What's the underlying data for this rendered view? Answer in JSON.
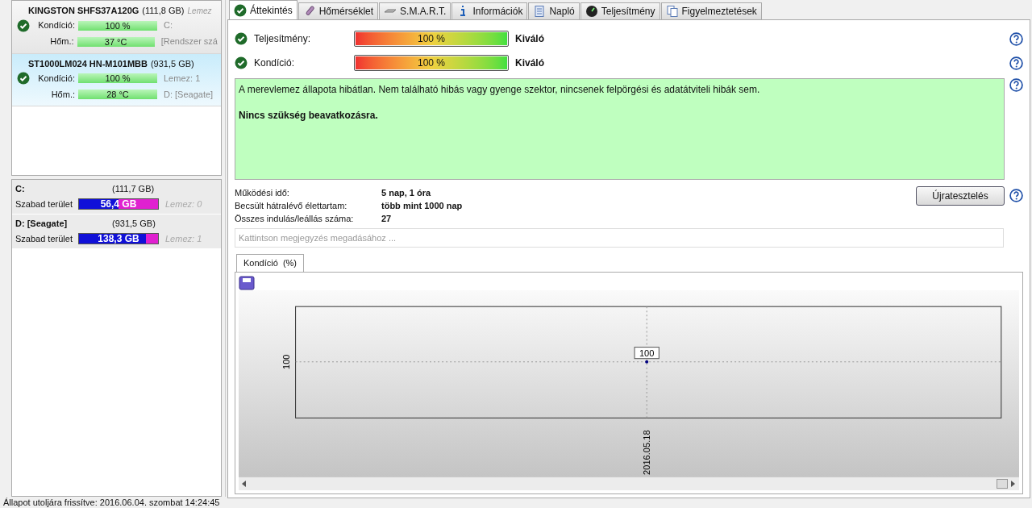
{
  "disks": [
    {
      "name": "KINGSTON SHFS37A120G",
      "size": "(111,8 GB)",
      "disk_label": "Lemez",
      "selected": false,
      "rows": [
        {
          "label": "Kondíció:",
          "reading": "100 %",
          "side": "C:",
          "status_icon": true
        },
        {
          "label": "Hőm.:",
          "reading": "37 °C",
          "side": "[Rendszer szá",
          "status_icon": false
        }
      ]
    },
    {
      "name": "ST1000LM024 HN-M101MBB",
      "size": "(931,5 GB)",
      "selected": true,
      "rows": [
        {
          "label": "Kondíció:",
          "reading": "100 %",
          "side": "Lemez: 1",
          "status_icon": true
        },
        {
          "label": "Hőm.:",
          "reading": "28 °C",
          "side": "D: [Seagate]",
          "status_icon": false
        }
      ]
    }
  ],
  "volumes": [
    {
      "name": "C:",
      "size": "(111,7 GB)",
      "label": "Szabad terület",
      "free": "56,4 GB",
      "level": 0.5,
      "disk": "Lemez: 0"
    },
    {
      "name": "D: [Seagate]",
      "size": "(931,5 GB)",
      "label": "Szabad terület",
      "free": "138,3 GB",
      "level": 0.85,
      "disk": "Lemez: 1"
    }
  ],
  "tabs": [
    {
      "label": "Áttekintés",
      "selected": true
    },
    {
      "label": "Hőmérséklet",
      "selected": false
    },
    {
      "label": "S.M.A.R.T.",
      "selected": false
    },
    {
      "label": "Információk",
      "selected": false
    },
    {
      "label": "Napló",
      "selected": false
    },
    {
      "label": "Teljesítmény",
      "selected": false
    },
    {
      "label": "Figyelmeztetések",
      "selected": false
    }
  ],
  "metrics": [
    {
      "label": "Teljesítmény:",
      "reading": "100 %",
      "level": 1,
      "rating": "Kiváló"
    },
    {
      "label": "Kondíció:",
      "reading": "100 %",
      "level": 1,
      "rating": "Kiváló"
    }
  ],
  "message": {
    "text": "A merevlemez állapota hibátlan. Nem található hibás vagy gyenge szektor, nincsenek felpörgési és adatátviteli hibák sem.",
    "action": "Nincs szükség beavatkozásra."
  },
  "stats": [
    {
      "label": "Működési idő:",
      "value": "5 nap, 1 óra"
    },
    {
      "label": "Becsült hátralévő élettartam:",
      "value": "több mint 1000 nap"
    },
    {
      "label": "Összes indulás/leállás száma:",
      "value": "27"
    }
  ],
  "retest_button": "Újratesztelés",
  "note_field": {
    "placeholder": "Kattintson megjegyzés megadásához ..."
  },
  "chart_tabs": [
    {
      "label": "Kondíció  (%)",
      "selected": true
    }
  ],
  "chart": {
    "y_axis_label": "100",
    "x_axis_label": "2016.05.18",
    "point_label": "100"
  },
  "status_bar": "Állapot utoljára frissítve: 2016.06.04. szombat 14:24:45"
}
